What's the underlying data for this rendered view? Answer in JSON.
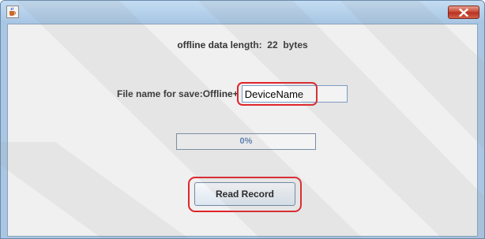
{
  "window": {
    "title": "",
    "close_symbol": "close-icon",
    "app_icon": "java-cup-icon"
  },
  "status": {
    "data_length_text": "offline data length:  22  bytes"
  },
  "file": {
    "label": "File name for save:Offline+",
    "value": "DeviceName"
  },
  "progress": {
    "value": 0,
    "text": "0%"
  },
  "actions": {
    "read_record_label": "Read Record"
  },
  "colors": {
    "highlight": "#e0242a",
    "progress_text": "#5a80b5",
    "close_button": "#c7432f"
  }
}
